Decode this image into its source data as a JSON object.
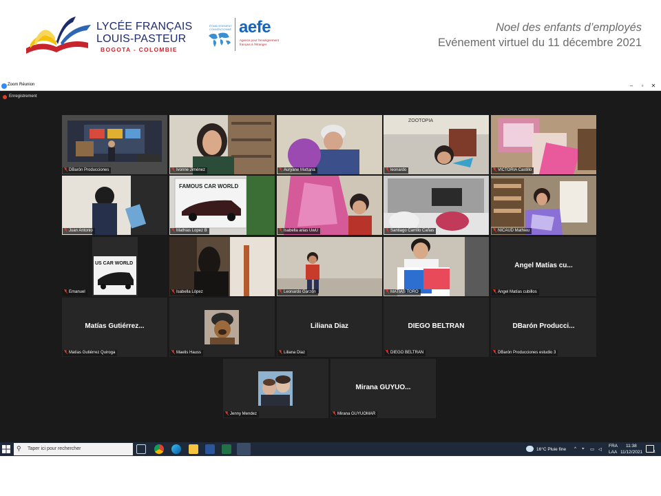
{
  "header": {
    "school_line1": "LYCÉE FRANÇAIS",
    "school_line2": "LOUIS-PASTEUR",
    "school_city": "BOGOTA - COLOMBIE",
    "aefe_small": "ÉTABLISSEMENT CONVENTIONNÉ",
    "aefe_word": "aefe",
    "aefe_desc": "Agence pour l'enseignement français à l'étranger",
    "event_title": "Noel des enfants d’employés",
    "event_date": "Evénement virtuel du 11 décembre 2021"
  },
  "window": {
    "title": "Zoom Réunion",
    "recording_label": "Enregistrement",
    "controls": [
      "–",
      "▫",
      "✕"
    ]
  },
  "tiles": [
    {
      "name": "DBarón Producciones",
      "big": "",
      "active": true
    },
    {
      "name": "Ivonne Jiménez",
      "big": ""
    },
    {
      "name": "Auryane Mattana",
      "big": ""
    },
    {
      "name": "leonardo",
      "big": ""
    },
    {
      "name": "VICTORIA Castillo",
      "big": ""
    },
    {
      "name": "Juan Antonio",
      "big": ""
    },
    {
      "name": "Mathias Lopez B",
      "big": ""
    },
    {
      "name": "Isabella arias UwU",
      "big": ""
    },
    {
      "name": "Santiago Carrillo Cañas",
      "big": ""
    },
    {
      "name": "NICAUD Mathieu",
      "big": ""
    },
    {
      "name": "Emanuel",
      "big": ""
    },
    {
      "name": "Isabella López",
      "big": ""
    },
    {
      "name": "Leonardo Garzón",
      "big": ""
    },
    {
      "name": "MATIAS TORO",
      "big": ""
    },
    {
      "name": "Ángel Matías cubillos",
      "big": "Ángel Matías cu..."
    },
    {
      "name": "Matías Gutiérrez Quiroga",
      "big": "Matías Gutiérrez..."
    },
    {
      "name": "Maelis Hauss",
      "big": ""
    },
    {
      "name": "Liliana Diaz",
      "big": "Liliana Diaz"
    },
    {
      "name": "DIEGO BELTRAN",
      "big": "DIEGO BELTRAN"
    },
    {
      "name": "DBarón Producciones estudio 3",
      "big": "DBarón Producci..."
    },
    {
      "name": "Jenny Mendez",
      "big": ""
    },
    {
      "name": "Mirana GUYUOMAR",
      "big": "Mirana GUYUO..."
    }
  ],
  "scene_text": {
    "famous_car": "FAMOUS CAR WORLD",
    "us_car": "US CAR WORLD",
    "zootopia": "ZOOTOPIA"
  },
  "taskbar": {
    "search_placeholder": "Taper ici pour rechercher",
    "weather": "16°C  Pluie fine",
    "lang1": "FRA",
    "lang2": "LAA",
    "time": "11:38",
    "date": "11/12/2021",
    "notif_count": "1"
  },
  "colors": {
    "zoom_bg": "#1a1a1a",
    "tile_bg": "#262626",
    "active_speaker": "#c8d43a",
    "mic_muted": "#e03e2d",
    "taskbar": "#1e2a3a"
  }
}
